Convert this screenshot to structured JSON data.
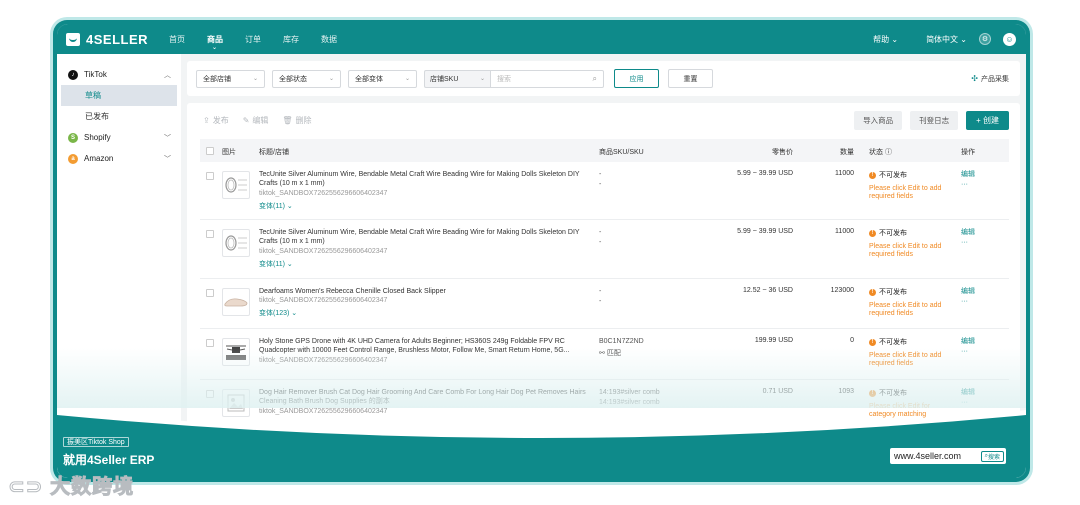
{
  "app": {
    "brand": "4SELLER"
  },
  "nav": {
    "items": [
      {
        "label": "首页",
        "active": false
      },
      {
        "label": "商品",
        "active": true
      },
      {
        "label": "订单",
        "active": false
      },
      {
        "label": "库存",
        "active": false
      },
      {
        "label": "数据",
        "active": false
      }
    ],
    "help": "帮助",
    "language": "简体中文"
  },
  "sidebar": {
    "tiktok": {
      "label": "TikTok",
      "sub": [
        "草稿",
        "已发布"
      ],
      "active_sub": "草稿"
    },
    "shopify": {
      "label": "Shopify"
    },
    "amazon": {
      "label": "Amazon"
    }
  },
  "filters": {
    "store": "全部店铺",
    "status": "全部状态",
    "variant": "全部变体",
    "sku_type": "店铺SKU",
    "search_placeholder": "搜索",
    "apply": "应用",
    "reset": "重置",
    "collect": "产品采集"
  },
  "toolbar": {
    "publish": "发布",
    "edit": "编辑",
    "delete": "删除",
    "import": "导入商品",
    "log": "刊登日志",
    "create": "+ 创建"
  },
  "table": {
    "headers": {
      "image": "图片",
      "title": "标题/店铺",
      "sku": "商品SKU/SKU",
      "price": "零售价",
      "qty": "数量",
      "status": "状态",
      "op": "操作"
    },
    "rows": [
      {
        "title": "TecUnite Silver Aluminum Wire, Bendable Metal Craft Wire Beading Wire for Making Dolls Skeleton DIY Crafts (10 m x 1 mm)",
        "store": "tiktok_SANDBOX7262556296606402347",
        "variant": "变体(11) ⌄",
        "sku1": "-",
        "sku2": "-",
        "match": "",
        "price": "5.99 ~ 39.99 USD",
        "qty": "11000",
        "status": "不可发布",
        "warn": "Please click Edit to add required fields",
        "op_edit": "编辑",
        "op_more": "···"
      },
      {
        "title": "TecUnite Silver Aluminum Wire, Bendable Metal Craft Wire Beading Wire for Making Dolls Skeleton DIY Crafts (10 m x 1 mm)",
        "store": "tiktok_SANDBOX7262556296606402347",
        "variant": "变体(11) ⌄",
        "sku1": "-",
        "sku2": "-",
        "match": "",
        "price": "5.99 ~ 39.99 USD",
        "qty": "11000",
        "status": "不可发布",
        "warn": "Please click Edit to add required fields",
        "op_edit": "编辑",
        "op_more": "···"
      },
      {
        "title": "Dearfoams Women's Rebecca Chenille Closed Back Slipper",
        "store": "tiktok_SANDBOX7262556296606402347",
        "variant": "变体(123) ⌄",
        "sku1": "-",
        "sku2": "-",
        "match": "",
        "price": "12.52 ~ 36 USD",
        "qty": "123000",
        "status": "不可发布",
        "warn": "Please click Edit to add required fields",
        "op_edit": "编辑",
        "op_more": "···"
      },
      {
        "title": "Holy Stone GPS Drone with 4K UHD Camera for Adults Beginner; HS360S 249g Foldable FPV RC Quadcopter with 10000 Feet Control Range, Brushless Motor, Follow Me, Smart Return Home, 5G...",
        "store": "tiktok_SANDBOX7262556296606402347",
        "variant": "",
        "sku1": "B0C1N7Z2ND",
        "sku2": "",
        "match": "匹配",
        "price": "199.99 USD",
        "qty": "0",
        "status": "不可发布",
        "warn": "Please click Edit to add required fields",
        "op_edit": "编辑",
        "op_more": "···"
      },
      {
        "title": "Dog Hair Remover Brush Cat Dog Hair Grooming And Care Comb For Long Hair Dog Pet Removes Hairs Cleaning Bath Brush Dog Supplies 的副本",
        "store": "tiktok_SANDBOX7262556296606402347",
        "variant": "",
        "sku1": "14:193#silver comb",
        "sku2": "14:193#silver comb",
        "match": "",
        "price": "0.71 USD",
        "qty": "1093",
        "status": "不可发布",
        "warn": "Please click Edit for category matching",
        "op_edit": "编辑",
        "op_more": "···"
      }
    ]
  },
  "banner": {
    "tag": "振美区Tiktok Shop",
    "title": "就用4Seller ERP",
    "url": "www.4seller.com",
    "search_btn": "搜索"
  },
  "watermark": "大数跨境",
  "colors": {
    "brand": "#0e8a8a",
    "warning": "#f08a24"
  }
}
